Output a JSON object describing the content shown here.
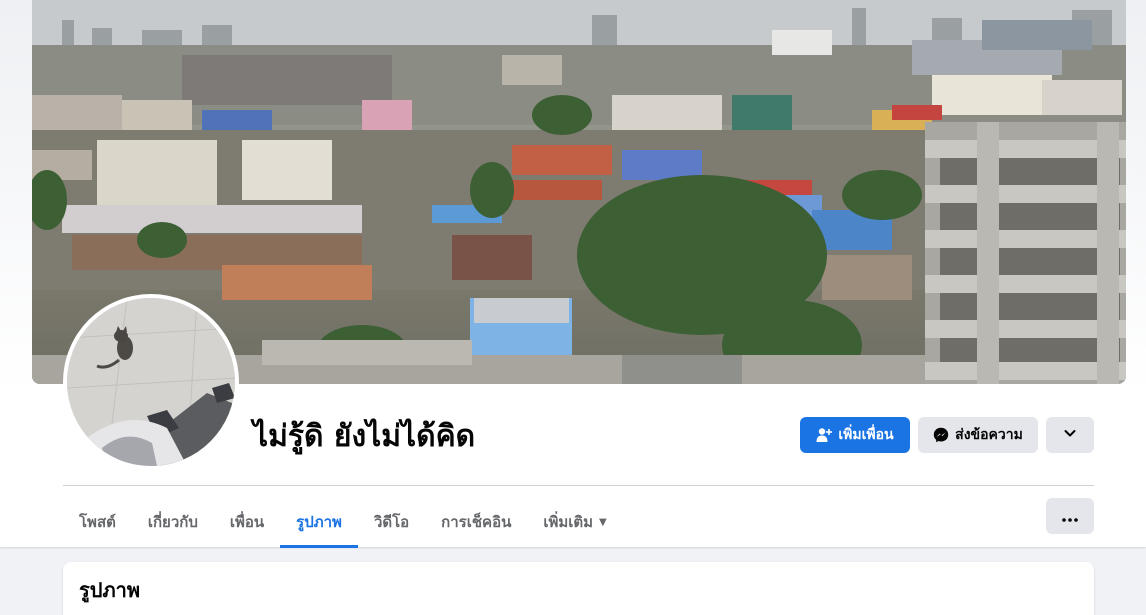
{
  "profile": {
    "name": "ไม่รู้ดิ ยังไม่ได้คิด"
  },
  "actions": {
    "add_friend_label": "เพิ่มเพื่อน",
    "message_label": "ส่งข้อความ"
  },
  "tabs": [
    {
      "label": "โพสต์"
    },
    {
      "label": "เกี่ยวกับ"
    },
    {
      "label": "เพื่อน"
    },
    {
      "label": "รูปภาพ",
      "active": true
    },
    {
      "label": "วิดีโอ"
    },
    {
      "label": "การเช็คอิน"
    },
    {
      "label": "เพิ่มเติม"
    }
  ],
  "photos_section": {
    "title": "รูปภาพ"
  },
  "icons": {
    "add_friend": "person-plus-icon",
    "message": "messenger-icon",
    "dropdown": "chevron-down-icon",
    "more_tab": "caret-down-icon",
    "ellipsis": "ellipsis-icon"
  },
  "colors": {
    "accent": "#1b74e4",
    "button_gray": "#e4e6eb",
    "page_bg": "#f0f2f5",
    "text_secondary": "#65676b"
  }
}
